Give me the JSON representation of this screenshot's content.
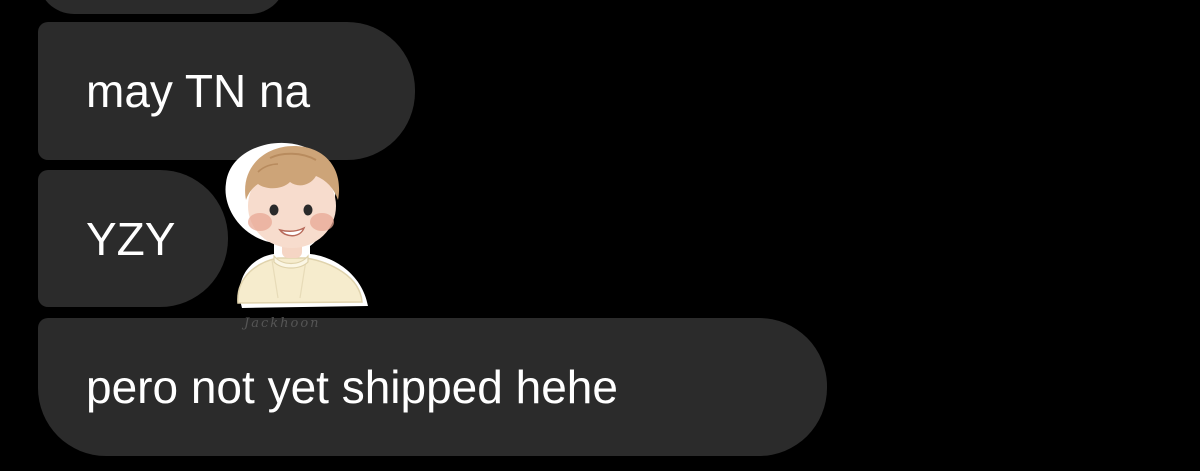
{
  "conversation": {
    "messages": [
      {
        "text": "may TN na"
      },
      {
        "text": "YZY"
      },
      {
        "text": "pero not yet shipped hehe"
      }
    ],
    "sticker": {
      "icon": "boy-avatar-sticker-icon",
      "signature": "Jackhoon"
    }
  },
  "colors": {
    "background": "#000000",
    "bubble": "#2b2b2b",
    "text": "#ffffff"
  }
}
